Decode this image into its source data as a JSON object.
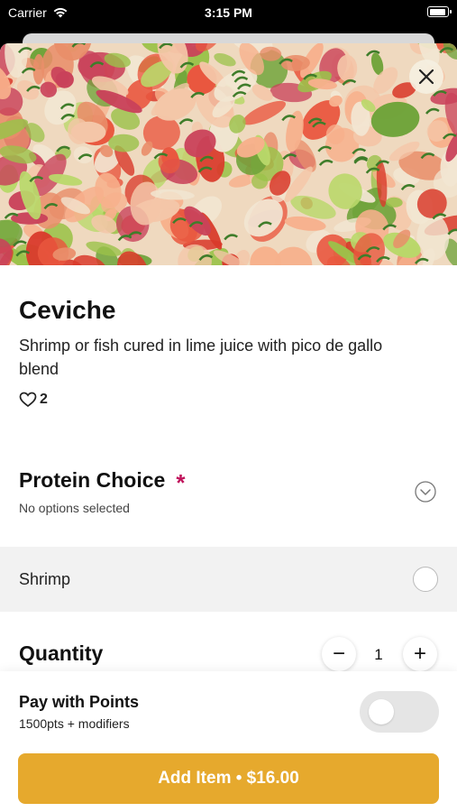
{
  "status_bar": {
    "carrier": "Carrier",
    "time": "3:15 PM"
  },
  "item": {
    "image": "ceviche-photo",
    "title": "Ceviche",
    "description": "Shrimp or fish cured in lime juice with pico de gallo blend",
    "likes": "2"
  },
  "protein_choice": {
    "title": "Protein Choice",
    "required_mark": "*",
    "subtitle": "No options selected",
    "options": [
      {
        "label": "Shrimp",
        "selected": false
      }
    ]
  },
  "quantity": {
    "title": "Quantity",
    "value": "1",
    "minus": "−",
    "plus": "+"
  },
  "pay_with_points": {
    "title": "Pay with Points",
    "subtitle": "1500pts + modifiers",
    "enabled": false
  },
  "add_button": {
    "label": "Add Item • $16.00"
  },
  "colors": {
    "accent": "#e6a92d",
    "required": "#c0135b",
    "option_bg": "#f2f2f2"
  }
}
